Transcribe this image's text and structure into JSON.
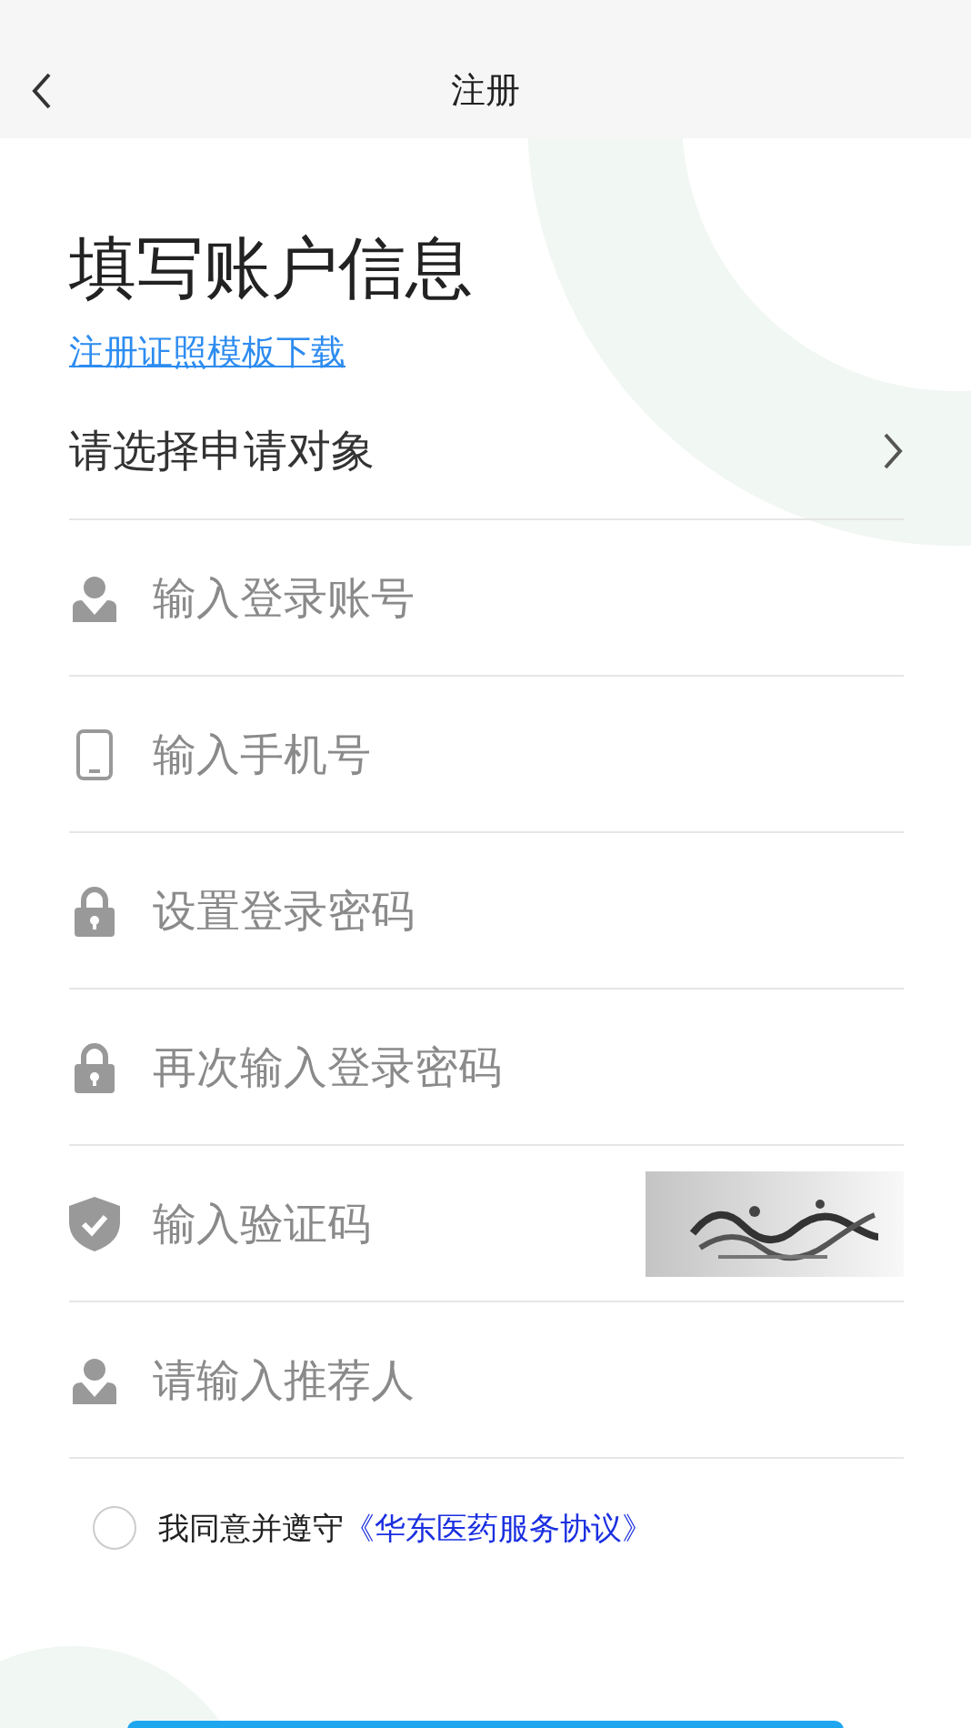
{
  "header": {
    "title": "注册"
  },
  "heading": "填写账户信息",
  "template_link": "注册证照模板下载",
  "applicant_select": {
    "label": "请选择申请对象"
  },
  "fields": [
    {
      "kind": "input",
      "placeholder": "输入登录账号"
    },
    {
      "kind": "input",
      "placeholder": "输入手机号"
    },
    {
      "kind": "password",
      "placeholder": "设置登录密码"
    },
    {
      "kind": "password",
      "placeholder": "再次输入登录密码"
    },
    {
      "kind": "captcha",
      "placeholder": "输入验证码"
    },
    {
      "kind": "input",
      "placeholder": "请输入推荐人"
    }
  ],
  "agreement": {
    "checked": false,
    "text": "我同意并遵守",
    "link": "《华东医药服务协议》"
  }
}
